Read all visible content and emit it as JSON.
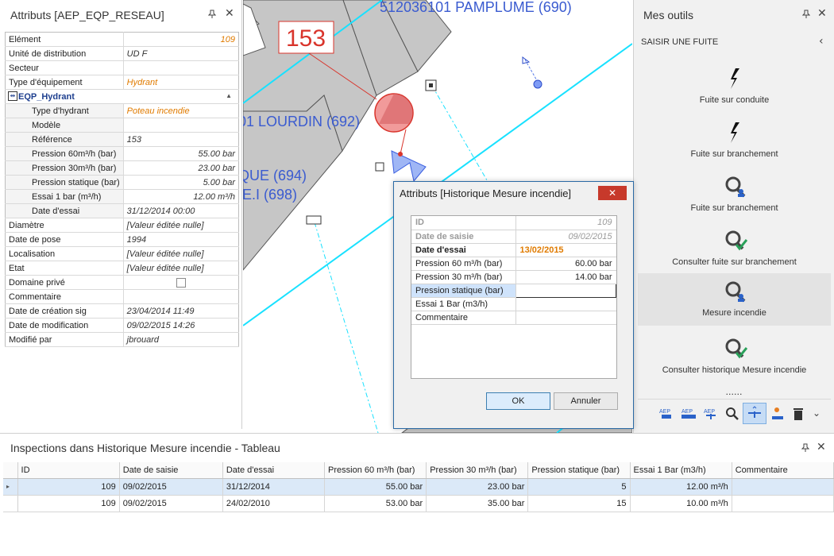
{
  "left_panel": {
    "title": "Attributs [AEP_EQP_RESEAU]",
    "pin_glyph": "📌",
    "close_glyph": "✕",
    "rows_top": [
      {
        "label": "Elément",
        "value": "109",
        "style": "orange-num"
      },
      {
        "label": "Unité de distribution",
        "value": "UD F",
        "style": "italic"
      },
      {
        "label": "Secteur",
        "value": "",
        "style": "italic"
      },
      {
        "label": "Type d'équipement",
        "value": "Hydrant",
        "style": "orange"
      }
    ],
    "group_label": "EQP_Hydrant",
    "sub_rows": [
      {
        "label": "Type d'hydrant",
        "value": "Poteau incendie",
        "style": "orange"
      },
      {
        "label": "Modèle",
        "value": "",
        "style": "italic"
      },
      {
        "label": "Référence",
        "value": "153",
        "style": "italic"
      },
      {
        "label": "Pression 60m³/h (bar)",
        "value": "55.00 bar",
        "style": "num"
      },
      {
        "label": "Pression 30m³/h (bar)",
        "value": "23.00 bar",
        "style": "num"
      },
      {
        "label": "Pression statique (bar)",
        "value": "5.00 bar",
        "style": "num"
      },
      {
        "label": "Essai 1 bar (m³/h)",
        "value": "12.00 m³/h",
        "style": "num"
      },
      {
        "label": "Date d'essai",
        "value": "31/12/2014 00:00",
        "style": "italic"
      }
    ],
    "rows_bottom": [
      {
        "label": "Diamètre",
        "value": "[Valeur éditée nulle]"
      },
      {
        "label": "Date de pose",
        "value": "1994"
      },
      {
        "label": "Localisation",
        "value": "[Valeur éditée nulle]"
      },
      {
        "label": "Etat",
        "value": "[Valeur éditée nulle]"
      },
      {
        "label": "Domaine privé",
        "value": ""
      },
      {
        "label": "Commentaire",
        "value": ""
      },
      {
        "label": "Date de création sig",
        "value": "23/04/2014 11:49"
      },
      {
        "label": "Date de modification",
        "value": "09/02/2015 14:26"
      },
      {
        "label": "Modifié par",
        "value": "jbrouard"
      }
    ]
  },
  "map": {
    "labels": {
      "parcel_top": "512036101 PAMPLUME (690)",
      "parcel_left": "01 LOURDIN (692)",
      "parcel_a": "QUE (694)",
      "parcel_b": ".E.I (698)",
      "callout": "153"
    },
    "colors": {
      "parcel": "#c9c9c9",
      "pipe": "#00e5ff",
      "label": "#3a5bd0",
      "callout": "#d9342b"
    }
  },
  "right_panel": {
    "title": "Mes outils",
    "section": "SAISIR UNE FUITE",
    "tools": [
      {
        "label": "Fuite sur conduite",
        "icon": "lightning-icon"
      },
      {
        "label": "Fuite sur branchement",
        "icon": "lightning-icon"
      },
      {
        "label": "Fuite sur branchement",
        "icon": "magnifier-user-icon"
      },
      {
        "label": "Consulter fuite sur branchement",
        "icon": "magnifier-check-icon"
      },
      {
        "label": "Mesure incendie",
        "icon": "magnifier-user-icon"
      },
      {
        "label": "Consulter historique Mesure incendie",
        "icon": "magnifier-check-icon"
      }
    ],
    "more_dots": "......",
    "toolbar_labels": [
      "AEP",
      "AEP",
      "AEP"
    ]
  },
  "dialog": {
    "title": "Attributs [Historique Mesure incendie]",
    "close_glyph": "✕",
    "rows": [
      {
        "label": "ID",
        "value": "109",
        "style": "dim"
      },
      {
        "label": "Date de saisie",
        "value": "09/02/2015",
        "style": "dim"
      },
      {
        "label": "Date d'essai",
        "value": "13/02/2015",
        "style": "bold"
      },
      {
        "label": "Pression 60 m³/h (bar)",
        "value": "60.00 bar",
        "style": ""
      },
      {
        "label": "Pression 30 m³/h (bar)",
        "value": "14.00 bar",
        "style": ""
      },
      {
        "label": "Pression statique (bar)",
        "value": "",
        "style": "focus"
      },
      {
        "label": "Essai 1 Bar (m3/h)",
        "value": "",
        "style": ""
      },
      {
        "label": "Commentaire",
        "value": "",
        "style": ""
      }
    ],
    "ok_label": "OK",
    "cancel_label": "Annuler"
  },
  "bottom_panel": {
    "title": "Inspections dans Historique Mesure incendie - Tableau",
    "columns": [
      "ID",
      "Date de saisie",
      "Date d'essai",
      "Pression 60 m³/h (bar)",
      "Pression 30 m³/h (bar)",
      "Pression statique (bar)",
      "Essai 1 Bar (m3/h)",
      "Commentaire"
    ],
    "rows": [
      [
        "109",
        "09/02/2015",
        "31/12/2014",
        "55.00 bar",
        "23.00 bar",
        "5",
        "12.00 m³/h",
        ""
      ],
      [
        "109",
        "09/02/2015",
        "24/02/2010",
        "53.00 bar",
        "35.00 bar",
        "15",
        "10.00 m³/h",
        ""
      ]
    ],
    "row_indicator": "▸"
  }
}
